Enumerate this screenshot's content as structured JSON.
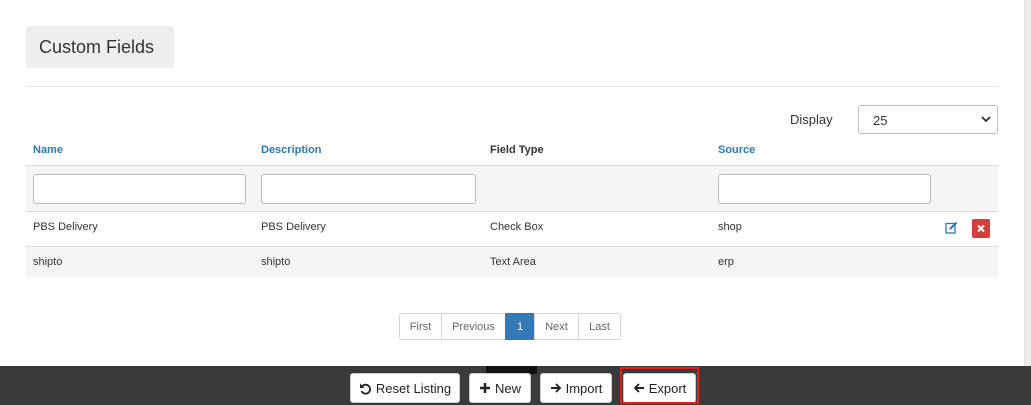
{
  "page": {
    "title": "Custom Fields",
    "display_label": "Display",
    "display_value": "25"
  },
  "table": {
    "headers": {
      "name": "Name",
      "description": "Description",
      "field_type": "Field Type",
      "source": "Source"
    },
    "rows": [
      {
        "name": "PBS Delivery",
        "description": "PBS Delivery",
        "field_type": "Check Box",
        "source": "shop"
      },
      {
        "name": "shipto",
        "description": "shipto",
        "field_type": "Text Area",
        "source": "erp"
      }
    ]
  },
  "pagination": {
    "first": "First",
    "previous": "Previous",
    "current": "1",
    "next": "Next",
    "last": "Last"
  },
  "footer": {
    "reset_label": "Reset Listing",
    "new_label": "New",
    "import_label": "Import",
    "export_label": "Export"
  },
  "colors": {
    "link_header": "#2a7ab8",
    "active_page": "#337ab7",
    "delete": "#d43f3a",
    "footer_bar": "#3a3a3a",
    "highlight_frame": "#e0201c"
  }
}
